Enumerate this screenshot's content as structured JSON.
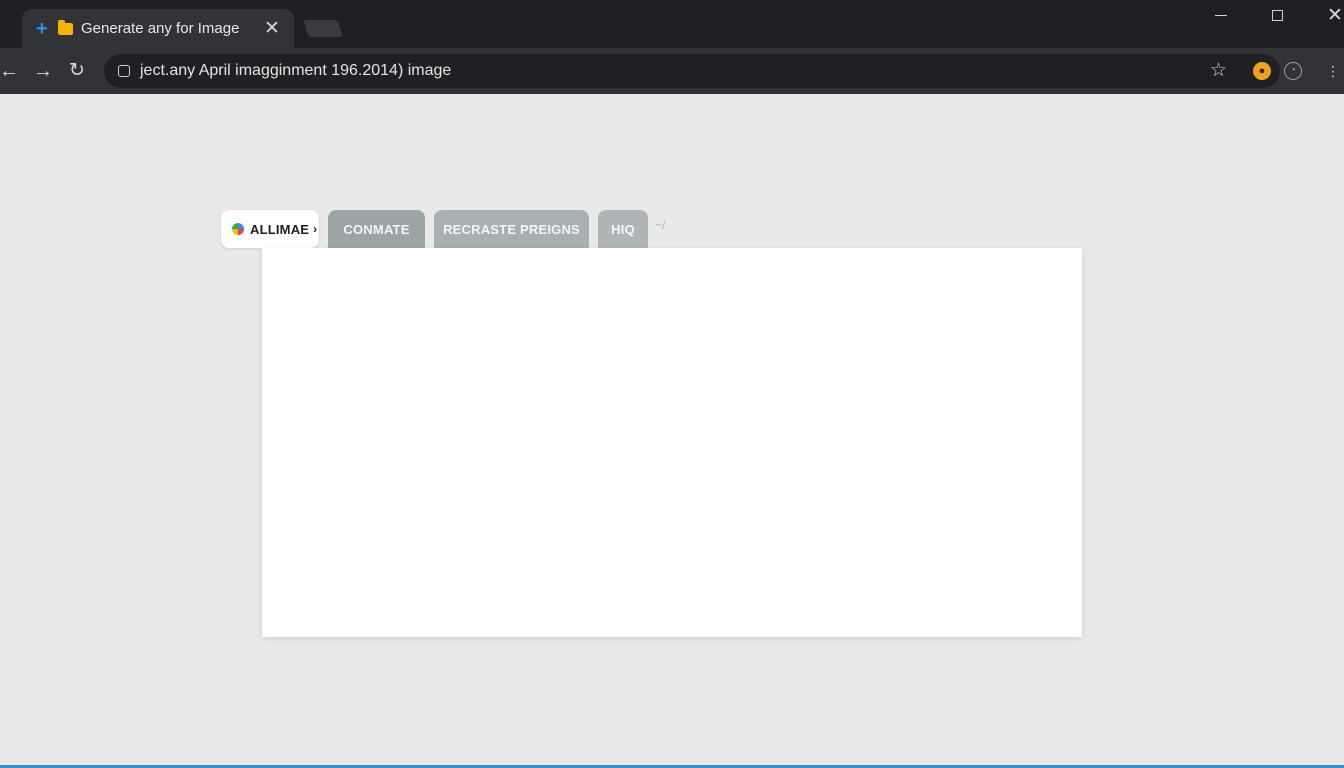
{
  "browser": {
    "tab": {
      "title": "Generate any for Image"
    },
    "address_bar": {
      "url": "ject.any April imagginment 196.2014) image"
    }
  },
  "page": {
    "chips": [
      {
        "label": "ALLIMAE"
      },
      {
        "label": "CONMATE"
      },
      {
        "label": "RECRASTE PREIGNS"
      },
      {
        "label": "HIQ"
      }
    ],
    "more_indicator": "~/"
  },
  "icons": {
    "tab_plus": "plus-icon",
    "tab_folder": "folder-icon",
    "tab_close": "close-icon",
    "back": "back-arrow-icon",
    "forward": "forward-arrow-icon",
    "reload": "reload-icon",
    "lock": "lock-icon",
    "bookmark": "star-icon",
    "extension_1": "extension-icon",
    "extension_2": "timer-icon",
    "menu": "menu-icon"
  },
  "colors": {
    "titlebar": "#1f2023",
    "toolbar": "#323336",
    "page_background": "#e9e9e9",
    "panel": "#ffffff",
    "chip_connate": "#9aa6a6",
    "chip_recraste": "#a8b0b2",
    "chip_hq": "#b0b5b8",
    "accent_blue": "#2f8fe0",
    "extension_orange": "#f0a21a"
  }
}
